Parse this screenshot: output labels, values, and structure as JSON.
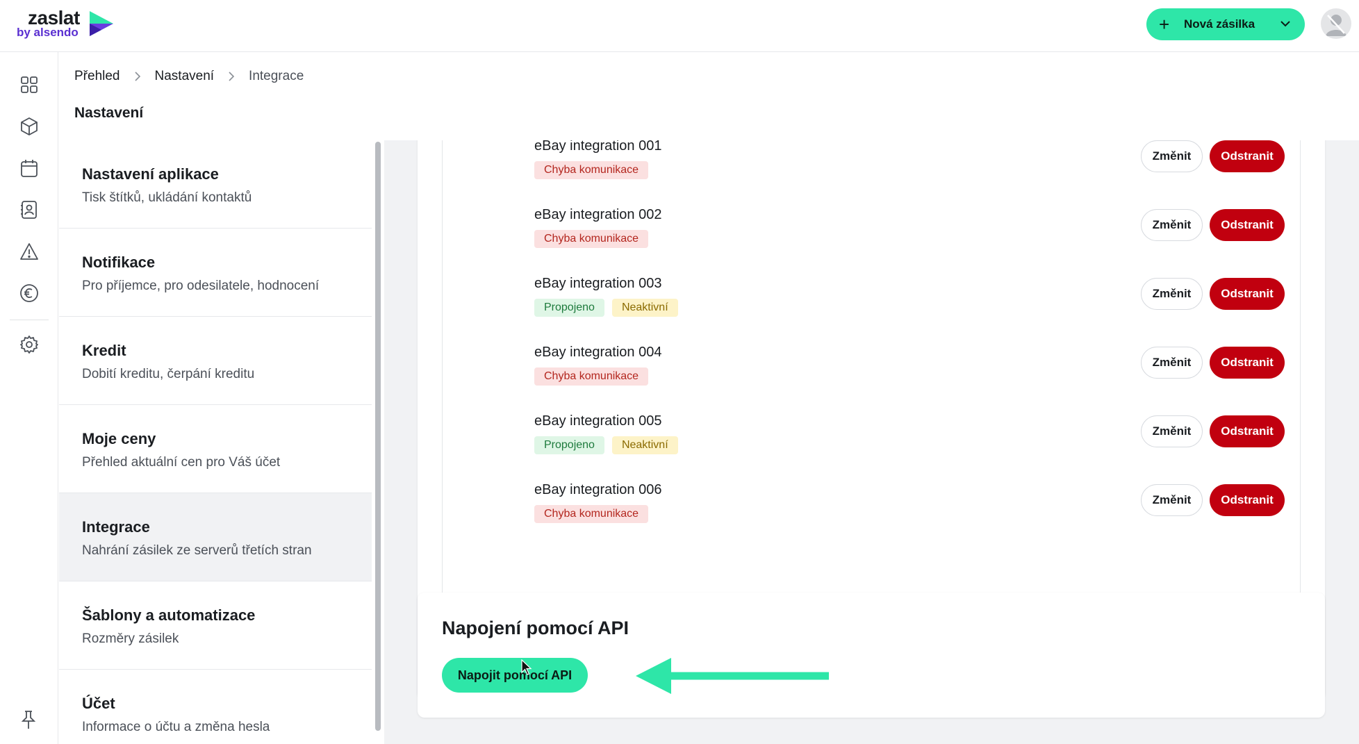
{
  "brand": {
    "name": "zaslat",
    "sub": "by alsendo"
  },
  "header": {
    "new_shipment_label": "Nová zásilka"
  },
  "rail": {
    "icons": [
      "grid-icon",
      "box-icon",
      "calendar-icon",
      "contacts-icon",
      "warning-icon",
      "euro-icon",
      "gear-icon"
    ],
    "pin_icon": "pin-icon"
  },
  "breadcrumb": {
    "items": [
      "Přehled",
      "Nastavení",
      "Integrace"
    ]
  },
  "page_title": "Nastavení",
  "settings_menu": {
    "items": [
      {
        "title": "Nastavení aplikace",
        "subtitle": "Tisk štítků, ukládání kontaktů"
      },
      {
        "title": "Notifikace",
        "subtitle": "Pro příjemce, pro odesilatele, hodnocení"
      },
      {
        "title": "Kredit",
        "subtitle": "Dobití kreditu, čerpání kreditu"
      },
      {
        "title": "Moje ceny",
        "subtitle": "Přehled aktuální cen pro Váš účet"
      },
      {
        "title": "Integrace",
        "subtitle": "Nahrání zásilek ze serverů třetích stran"
      },
      {
        "title": "Šablony a automatizace",
        "subtitle": "Rozměry zásilek"
      },
      {
        "title": "Účet",
        "subtitle": "Informace o účtu a změna hesla"
      }
    ],
    "active_index": 4
  },
  "integrations": {
    "edit_label": "Změnit",
    "delete_label": "Odstranit",
    "items": [
      {
        "name": "eBay integration 001",
        "tags": [
          {
            "label": "Chyba komunikace",
            "kind": "err"
          }
        ]
      },
      {
        "name": "eBay integration 002",
        "tags": [
          {
            "label": "Chyba komunikace",
            "kind": "err"
          }
        ]
      },
      {
        "name": "eBay integration 003",
        "tags": [
          {
            "label": "Propojeno",
            "kind": "ok"
          },
          {
            "label": "Neaktivní",
            "kind": "warn"
          }
        ]
      },
      {
        "name": "eBay integration 004",
        "tags": [
          {
            "label": "Chyba komunikace",
            "kind": "err"
          }
        ]
      },
      {
        "name": "eBay integration 005",
        "tags": [
          {
            "label": "Propojeno",
            "kind": "ok"
          },
          {
            "label": "Neaktivní",
            "kind": "warn"
          }
        ]
      },
      {
        "name": "eBay integration 006",
        "tags": [
          {
            "label": "Chyba komunikace",
            "kind": "err"
          }
        ]
      }
    ]
  },
  "api_section": {
    "heading": "Napojení pomocí API",
    "button_label": "Napojit pomocí API"
  },
  "colors": {
    "accent": "#2ee6a8",
    "danger": "#c1000f",
    "brand_purple": "#5a2fd1"
  }
}
